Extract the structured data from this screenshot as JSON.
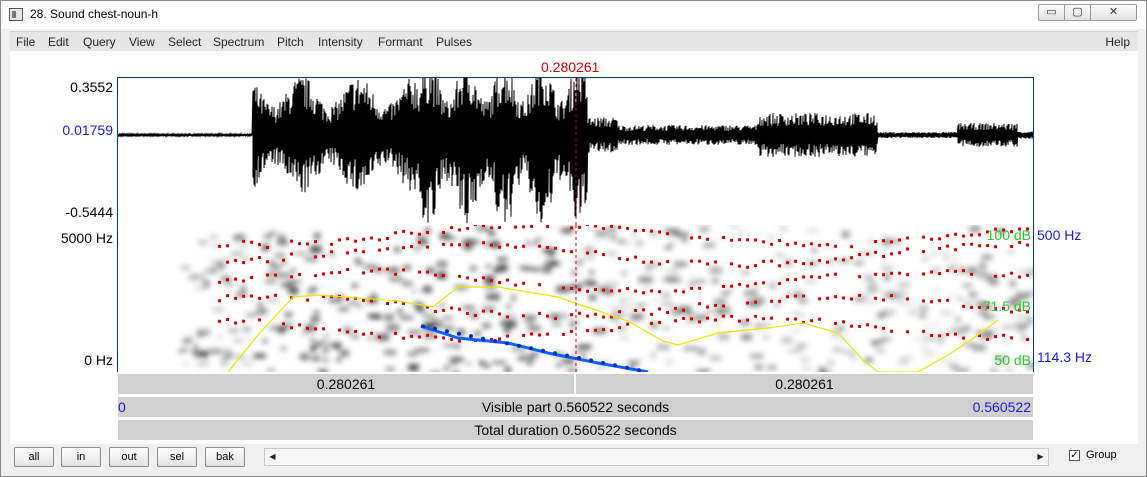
{
  "window": {
    "title": "28. Sound chest-noun-h",
    "min_glyph": "▭",
    "max_glyph": "▢",
    "close_glyph": "✕"
  },
  "menu": {
    "items": [
      "File",
      "Edit",
      "Query",
      "View",
      "Select",
      "Spectrum",
      "Pitch",
      "Intensity",
      "Formant",
      "Pulses"
    ],
    "help": "Help"
  },
  "cursor": {
    "time_label": "0.280261",
    "color": "#d00000"
  },
  "waveform": {
    "max_label": "0.3552",
    "cursor_value_label": "0.01759",
    "min_label": "-0.5444",
    "cursor_value_color": "#1a1adc"
  },
  "spectrogram": {
    "top_freq_label": "5000 Hz",
    "bottom_freq_label": "0 Hz",
    "intensity_top_label": "100 dB",
    "intensity_mid_label": "71.5 dB",
    "intensity_bottom_label": "50 dB",
    "pitch_top_label": "500 Hz",
    "pitch_bottom_label": "114.3 Hz",
    "intensity_color": "#2fc42f",
    "pitch_color": "#1a1adc",
    "formant_color": "#e00000",
    "intensity_curve_color": "#e8e800",
    "pitch_curve_color": "#1060ff"
  },
  "time_bars": {
    "left_segment": "0.280261",
    "right_segment": "0.280261",
    "visible_start": "0",
    "visible_label": "Visible part 0.560522 seconds",
    "visible_end": "0.560522",
    "total_label": "Total duration 0.560522 seconds"
  },
  "controls": {
    "buttons": [
      "all",
      "in",
      "out",
      "sel",
      "bak"
    ],
    "scroll_left": "◀",
    "scroll_right": "▶",
    "group_label": "Group",
    "group_checked": true,
    "check_glyph": "✓"
  },
  "icons": {
    "app": "praat-sound-window-icon"
  }
}
